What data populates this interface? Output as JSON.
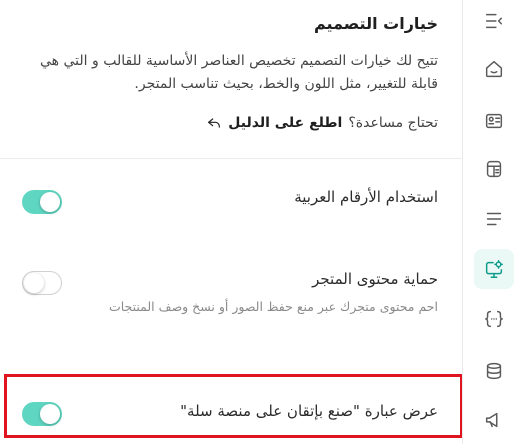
{
  "section": {
    "title": "خيارات التصميم",
    "description": "تتيح لك خيارات التصميم تخصيص العناصر الأساسية للقالب و التي هي قابلة للتغيير، مثل اللون والخط، بحيث تناسب المتجر.",
    "help_prompt": "تحتاج مساعدة؟",
    "help_link": "اطلع على الدليل"
  },
  "settings": [
    {
      "label": "استخدام الأرقام العربية",
      "enabled": true
    },
    {
      "label": "حماية محتوى المتجر",
      "sublabel": "احم محتوى متجرك عبر منع حفظ الصور أو نسخ وصف المنتجات",
      "enabled": false
    },
    {
      "label": "عرض عبارة \"صنع بإتقان على منصة سلة\"",
      "enabled": true
    }
  ],
  "sidebar": {
    "icons": [
      "list-collapse-icon",
      "home-icon",
      "id-card-icon",
      "layout-icon",
      "menu-icon",
      "monitor-settings-icon",
      "code-braces-icon",
      "database-icon",
      "megaphone-icon"
    ],
    "active_index": 5
  },
  "colors": {
    "accent": "#5fd6c1",
    "active_icon": "#0d9b8a",
    "highlight": "#e0141e"
  }
}
